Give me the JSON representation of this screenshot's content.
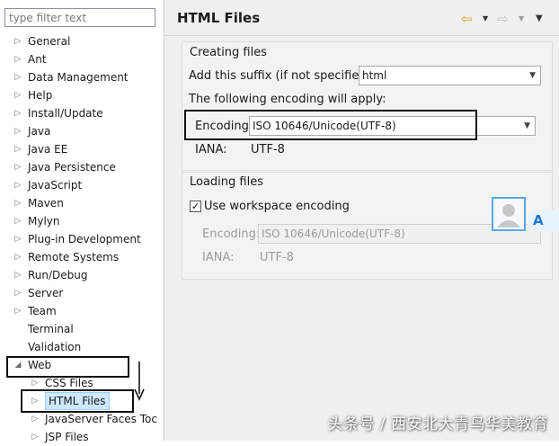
{
  "filter": {
    "placeholder": "type filter text"
  },
  "tree": {
    "items": [
      {
        "label": "General"
      },
      {
        "label": "Ant"
      },
      {
        "label": "Data Management"
      },
      {
        "label": "Help"
      },
      {
        "label": "Install/Update"
      },
      {
        "label": "Java"
      },
      {
        "label": "Java EE"
      },
      {
        "label": "Java Persistence"
      },
      {
        "label": "JavaScript"
      },
      {
        "label": "Maven"
      },
      {
        "label": "Mylyn"
      },
      {
        "label": "Plug-in Development"
      },
      {
        "label": "Remote Systems"
      },
      {
        "label": "Run/Debug"
      },
      {
        "label": "Server"
      },
      {
        "label": "Team"
      },
      {
        "label": "Terminal"
      },
      {
        "label": "Validation"
      },
      {
        "label": "Web"
      }
    ],
    "web_children": [
      {
        "label": "CSS Files"
      },
      {
        "label": "HTML Files"
      },
      {
        "label": "JavaServer Faces Toc"
      },
      {
        "label": "JSP Files"
      }
    ]
  },
  "page": {
    "title": "HTML Files",
    "creating": {
      "title": "Creating files",
      "suffix_label": "Add this suffix (if not specified):",
      "suffix_value": "html",
      "encoding_note": "The following encoding will apply:",
      "encoding_label": "Encoding:",
      "encoding_value": "ISO 10646/Unicode(UTF-8)",
      "iana_label": "IANA:",
      "iana_value": "UTF-8"
    },
    "loading": {
      "title": "Loading files",
      "checkbox_label": "Use workspace encoding",
      "checked": true,
      "encoding_label": "Encoding:",
      "encoding_value": "ISO 10646/Unicode(UTF-8)",
      "iana_label": "IANA:",
      "iana_value": "UTF-8"
    }
  },
  "overlay": {
    "translate_badge": "A",
    "watermark": "头条号 / 西安北大青鸟华美教育"
  },
  "colors": {
    "selection_bg": "#cde8ff",
    "accent_blue": "#1e78d2",
    "back_arrow": "#e0a020"
  }
}
